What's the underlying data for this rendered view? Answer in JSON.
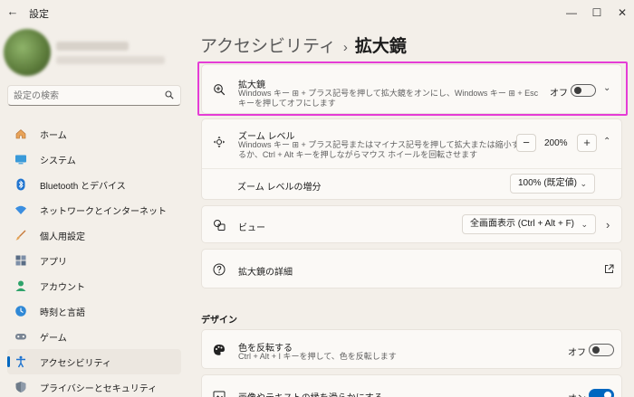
{
  "window": {
    "title": "設定",
    "controls": {
      "minimize": "—",
      "maximize": "☐",
      "close": "✕"
    },
    "back": "←"
  },
  "search": {
    "placeholder": "設定の検索"
  },
  "sidebar": {
    "items": [
      {
        "label": "ホーム",
        "icon": "home-icon"
      },
      {
        "label": "システム",
        "icon": "system-icon"
      },
      {
        "label": "Bluetooth とデバイス",
        "icon": "bluetooth-icon"
      },
      {
        "label": "ネットワークとインターネット",
        "icon": "wifi-icon"
      },
      {
        "label": "個人用設定",
        "icon": "brush-icon"
      },
      {
        "label": "アプリ",
        "icon": "apps-icon"
      },
      {
        "label": "アカウント",
        "icon": "account-icon"
      },
      {
        "label": "時刻と言語",
        "icon": "clock-globe-icon"
      },
      {
        "label": "ゲーム",
        "icon": "gamepad-icon"
      },
      {
        "label": "アクセシビリティ",
        "icon": "accessibility-icon",
        "active": true
      },
      {
        "label": "プライバシーとセキュリティ",
        "icon": "shield-icon"
      }
    ]
  },
  "breadcrumb": {
    "parent": "アクセシビリティ",
    "separator": "›",
    "current": "拡大鏡"
  },
  "magnifier": {
    "title": "拡大鏡",
    "desc_line1": "Windows キー ⊞ + プラス記号を押して拡大鏡をオンにし、Windows キー ⊞ + Esc",
    "desc_line2": "キーを押してオフにします",
    "state_label": "オフ",
    "on": false,
    "expand": "⌄"
  },
  "zoom": {
    "title": "ズーム レベル",
    "desc_line1": "Windows キー ⊞ + プラス記号またはマイナス記号を押して拡大または縮小す",
    "desc_line2": "るか、Ctrl + Alt キーを押しながらマウス ホイールを回転させます",
    "minus": "−",
    "value": "200%",
    "plus": "+",
    "collapse": "⌃"
  },
  "zoom_increment": {
    "label": "ズーム レベルの増分",
    "value": "100% (既定値)"
  },
  "view": {
    "label": "ビュー",
    "value": "全画面表示 (Ctrl + Alt + F)",
    "chevron": "›"
  },
  "details": {
    "label": "拡大鏡の詳細"
  },
  "design_section": {
    "heading": "デザイン"
  },
  "invert_colors": {
    "title": "色を反転する",
    "desc": "Ctrl + Alt + I キーを押して、色を反転します",
    "state_label": "オフ",
    "on": false
  },
  "smooth_edges": {
    "title": "画像やテキストの縁を滑らかにする",
    "state_label": "オン",
    "on": true
  },
  "colors": {
    "accent": "#0067c0",
    "highlight": "#e53cd6",
    "background": "#f3efe9",
    "card": "#fbf9f6"
  }
}
